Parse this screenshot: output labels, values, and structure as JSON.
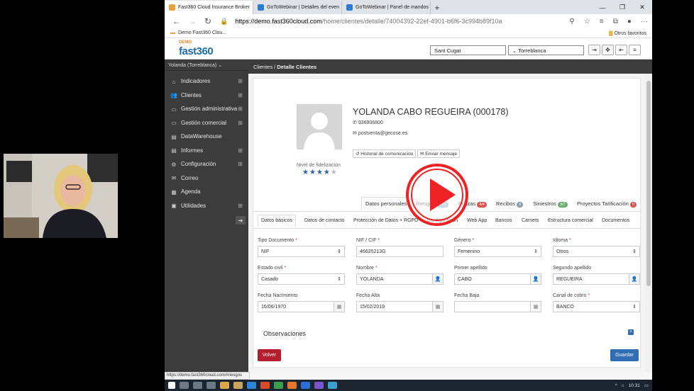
{
  "browser": {
    "tabs": [
      {
        "title": "Fast360 Cloud Insurance Broker",
        "active": true,
        "icon_color": "#e8a23a"
      },
      {
        "title": "GoToWebinar | Detalles del even",
        "active": false,
        "icon_color": "#2a7bd3"
      },
      {
        "title": "GoToWebinar | Panel de mandos",
        "active": false,
        "icon_color": "#2a7bd3"
      }
    ],
    "new_tab_icon": "plus-icon",
    "window_controls": [
      "—",
      "❐",
      "✕"
    ],
    "url_domain": "https://demo.fast360cloud.com",
    "url_path": "/home/clientes/detalle/74004392-22ef-4901-b6f6-3c994b89f10a",
    "bookmark": "Demo Fast360 Clou...",
    "bookmarks_other": "Otros favoritos"
  },
  "app": {
    "logo_demo": "DEMO",
    "logo_brand": "fast360",
    "office_select": "Sant Cugat",
    "agency_select": "Torreblanca",
    "user": "Yolanda (Torreblanca)",
    "menu": [
      {
        "label": "Indicadores",
        "icon": "home-icon",
        "glyph": "⌂",
        "expandable": true
      },
      {
        "label": "Clientes",
        "icon": "users-icon",
        "glyph": "👥",
        "expandable": true
      },
      {
        "label": "Gestión administrativa",
        "icon": "monitor-icon",
        "glyph": "▭",
        "expandable": true
      },
      {
        "label": "Gestión comercial",
        "icon": "monitor-icon",
        "glyph": "▭",
        "expandable": true
      },
      {
        "label": "DataWarehouse",
        "icon": "file-icon",
        "glyph": "▤",
        "expandable": false
      },
      {
        "label": "Informes",
        "icon": "report-icon",
        "glyph": "▤",
        "expandable": true
      },
      {
        "label": "Configuración",
        "icon": "gear-icon",
        "glyph": "⚙",
        "expandable": true
      },
      {
        "label": "Correo",
        "icon": "mail-icon",
        "glyph": "✉",
        "expandable": false
      },
      {
        "label": "Agenda",
        "icon": "calendar-icon",
        "glyph": "▦",
        "expandable": false
      },
      {
        "label": "Utilidades",
        "icon": "tools-icon",
        "glyph": "▣",
        "expandable": true
      }
    ],
    "breadcrumb": {
      "root": "Clientes /",
      "current": "Detalle Clientes"
    }
  },
  "client": {
    "name": "YOLANDA CABO REGUEIRA (000178)",
    "phone": "936906800",
    "email": "postventa@gecose.es",
    "btn_history": "Historial de comunicación",
    "btn_message": "Enviar mensaje",
    "loyalty_label": "Nivel de fidelización",
    "loyalty_stars": 4,
    "loyalty_max": 5
  },
  "top_tabs": [
    {
      "label": "Datos personales",
      "badge": "",
      "color": ""
    },
    {
      "label": "Riesgos",
      "badge": "4/10",
      "color": "#8aa6bf"
    },
    {
      "label": "Pólizas",
      "badge": "4/4",
      "color": "#d9534f"
    },
    {
      "label": "Recibos",
      "badge": "9",
      "color": "#8c9aa8"
    },
    {
      "label": "Siniestros",
      "badge": "3/7",
      "color": "#6bae72"
    },
    {
      "label": "Proyectos Tarificación",
      "badge": "0",
      "color": "#d9534f"
    }
  ],
  "sub_tabs": [
    "Datos básicos",
    "Datos de contacto",
    "Protección de Datos + RGPD",
    "Configuración",
    "Web App",
    "Bancos",
    "Carnets",
    "Estructura comercial",
    "Documentos"
  ],
  "form": {
    "tipo_documento": {
      "label": "Tipo Documento",
      "value": "NIF"
    },
    "nif": {
      "label": "NIF / CIF",
      "value": "46625213G"
    },
    "genero": {
      "label": "Género",
      "value": "Femenino"
    },
    "idioma": {
      "label": "Idioma",
      "value": "Otros"
    },
    "estado_civil": {
      "label": "Estado civil",
      "value": "Casado"
    },
    "nombre": {
      "label": "Nombre",
      "value": "YOLANDA"
    },
    "apellido1": {
      "label": "Primer apellido",
      "value": "CABO"
    },
    "apellido2": {
      "label": "Segundo apellido",
      "value": "REGUEIRA"
    },
    "fecha_nac": {
      "label": "Fecha Nacimiento",
      "value": "16/06/1970"
    },
    "fecha_alta": {
      "label": "Fecha Alta",
      "value": "15/02/2019"
    },
    "fecha_baja": {
      "label": "Fecha Baja",
      "value": ""
    },
    "canal_cobro": {
      "label": "Canal de cobro",
      "value": "BANCO"
    }
  },
  "observaciones": "Observaciones",
  "buttons": {
    "volver": "Volver",
    "guardar": "Guardar"
  },
  "status_url": "https://demo.fast360cloud.com/#riesgos",
  "taskbar_time": "10:31"
}
